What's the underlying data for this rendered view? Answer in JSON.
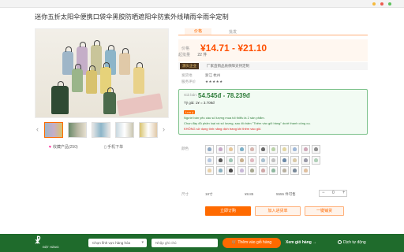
{
  "product": {
    "title": "迷你五折太阳伞便携口袋伞黑胶防晒遮阳伞防紫外线晴雨伞雨伞定制"
  },
  "gallery": {
    "favorites": "收藏产品(250)",
    "phone": "手机下单"
  },
  "detail": {
    "tabs": [
      "价格",
      "批发"
    ],
    "price_label": "价格",
    "price_range": "¥14.71 - ¥21.10",
    "qty_label": "起批量",
    "qty_value": "22 件",
    "shop_badge": "源头企业",
    "shop_name": "厂家直销品质保障支持定制",
    "rows": [
      {
        "label": "发货地",
        "value": "浙江 杭州"
      },
      {
        "label": "服务评价",
        "value": "★★★★★"
      }
    ]
  },
  "vn_box": {
    "label": "Giá bán:",
    "price": "54.545đ - 78.239đ",
    "rate": "Tỷ giá: 1¥ = 3.708đ",
    "badge": "Lưu ý",
    "lines": [
      "Người bán yêu cầu số lượng mua tối thiểu là 2 sản phẩm.",
      "Chọn đầy đủ phân loại và số lượng, sau đó bấm \"Thêm vào giỏ hàng\" dưới thanh công cụ.",
      "KHÔNG sử dụng tính năng dịch trang khi thêm vào giỏ."
    ]
  },
  "variants": {
    "label": "颜色",
    "colors": [
      "#8fa9c4",
      "#c7a9c9",
      "#e6c79a",
      "#7db0c8",
      "#d7b6b0",
      "#6a6a6a",
      "#b9d1a8",
      "#e2d5a0",
      "#a0b8d8",
      "#cfa8b8",
      "#8f8f8f",
      "#b5c7e0",
      "#5a5a5a",
      "#9ec7b5",
      "#c9b18f",
      "#e0b8c0",
      "#a8c0d0",
      "#c0c0c0",
      "#6d8aa8",
      "#d8c8a8",
      "#9a9aa8",
      "#b0d0b8",
      "#e8d0a8",
      "#8ab0c0",
      "#4a4a4a",
      "#c8b8d8",
      "#a8a890",
      "#d0a8a8",
      "#90b8a0",
      "#b8b0a0",
      "#7a8a9a",
      "#e0c0a0"
    ]
  },
  "quantity": {
    "label": "尺寸",
    "size": "18寸",
    "price": "¥8.85",
    "stock": "5555 件可售",
    "value": "0"
  },
  "buttons": {
    "buy": "立即订购",
    "cart": "加入进货单",
    "fav": "一键铺货"
  },
  "bottombar": {
    "logo": "☧",
    "logo_text": "ĐẶT HÀNG",
    "select_label": "Chọn lĩnh vực hàng hóa",
    "note_placeholder": "Nhập ghi chú",
    "add_cart": "🛒 Thêm vào giỏ hàng",
    "view_cart": "Xem giỏ hàng →",
    "translate": "Dịch tự động"
  },
  "colors": {
    "accent": "#ff6a00",
    "green": "#1f6b2c"
  }
}
